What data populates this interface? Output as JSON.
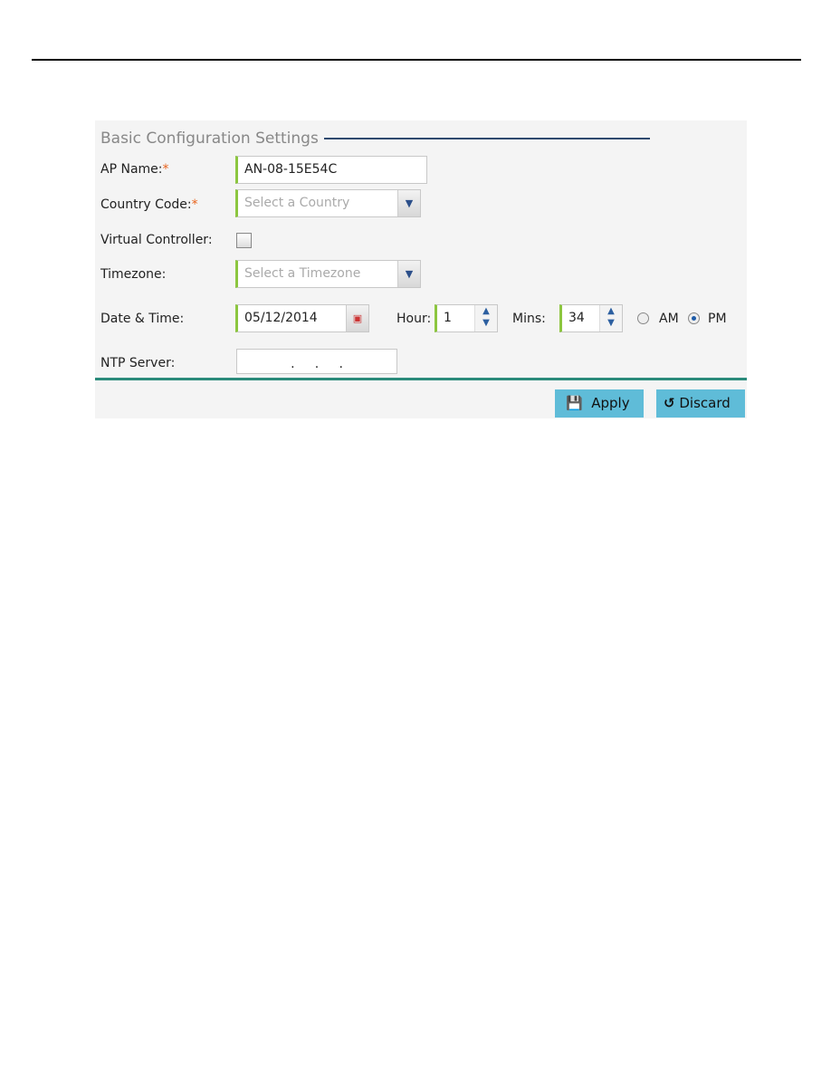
{
  "section_title": "Basic Configuration Settings",
  "fields": {
    "ap_name": {
      "label": "AP Name:",
      "required": "*",
      "value": "AN-08-15E54C"
    },
    "country": {
      "label": "Country Code:",
      "required": "*",
      "placeholder": "Select a Country"
    },
    "virtual_controller": {
      "label": "Virtual Controller:",
      "checked": false
    },
    "timezone": {
      "label": "Timezone:",
      "placeholder": "Select a Timezone"
    },
    "datetime": {
      "label": "Date & Time:",
      "date": "05/12/2014",
      "hour_label": "Hour:",
      "hour": "1",
      "mins_label": "Mins:",
      "mins": "34",
      "am": "AM",
      "pm": "PM",
      "selected": "PM"
    },
    "ntp": {
      "label": "NTP Server:",
      "dots": ".     .     ."
    }
  },
  "buttons": {
    "apply": "Apply",
    "discard": "Discard"
  },
  "colors": {
    "accent": "#8cc63f",
    "button": "#5fbcd8",
    "divider": "#2a8a7a"
  }
}
